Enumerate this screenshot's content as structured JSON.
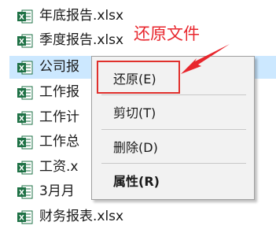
{
  "files": [
    {
      "name": "年底报告.xlsx",
      "selected": false
    },
    {
      "name": "季度报告.xlsx",
      "selected": false
    },
    {
      "name": "公司报",
      "selected": true
    },
    {
      "name": "工作报",
      "selected": false
    },
    {
      "name": "工作计",
      "selected": false
    },
    {
      "name": "工作总",
      "selected": false
    },
    {
      "name": "工资.x",
      "selected": false
    },
    {
      "name": "3月月",
      "selected": false
    },
    {
      "name": "财务报表.xlsx",
      "selected": false
    }
  ],
  "context_menu": {
    "restore": "还原(E)",
    "cut": "剪切(T)",
    "delete": "删除(D)",
    "properties": "属性(R)"
  },
  "annotation": {
    "text": "还原文件",
    "color": "#e8262d"
  },
  "colors": {
    "excel_green": "#1e7145",
    "selection": "#cce8ff"
  },
  "icons": {
    "file": "excel-file-icon"
  }
}
